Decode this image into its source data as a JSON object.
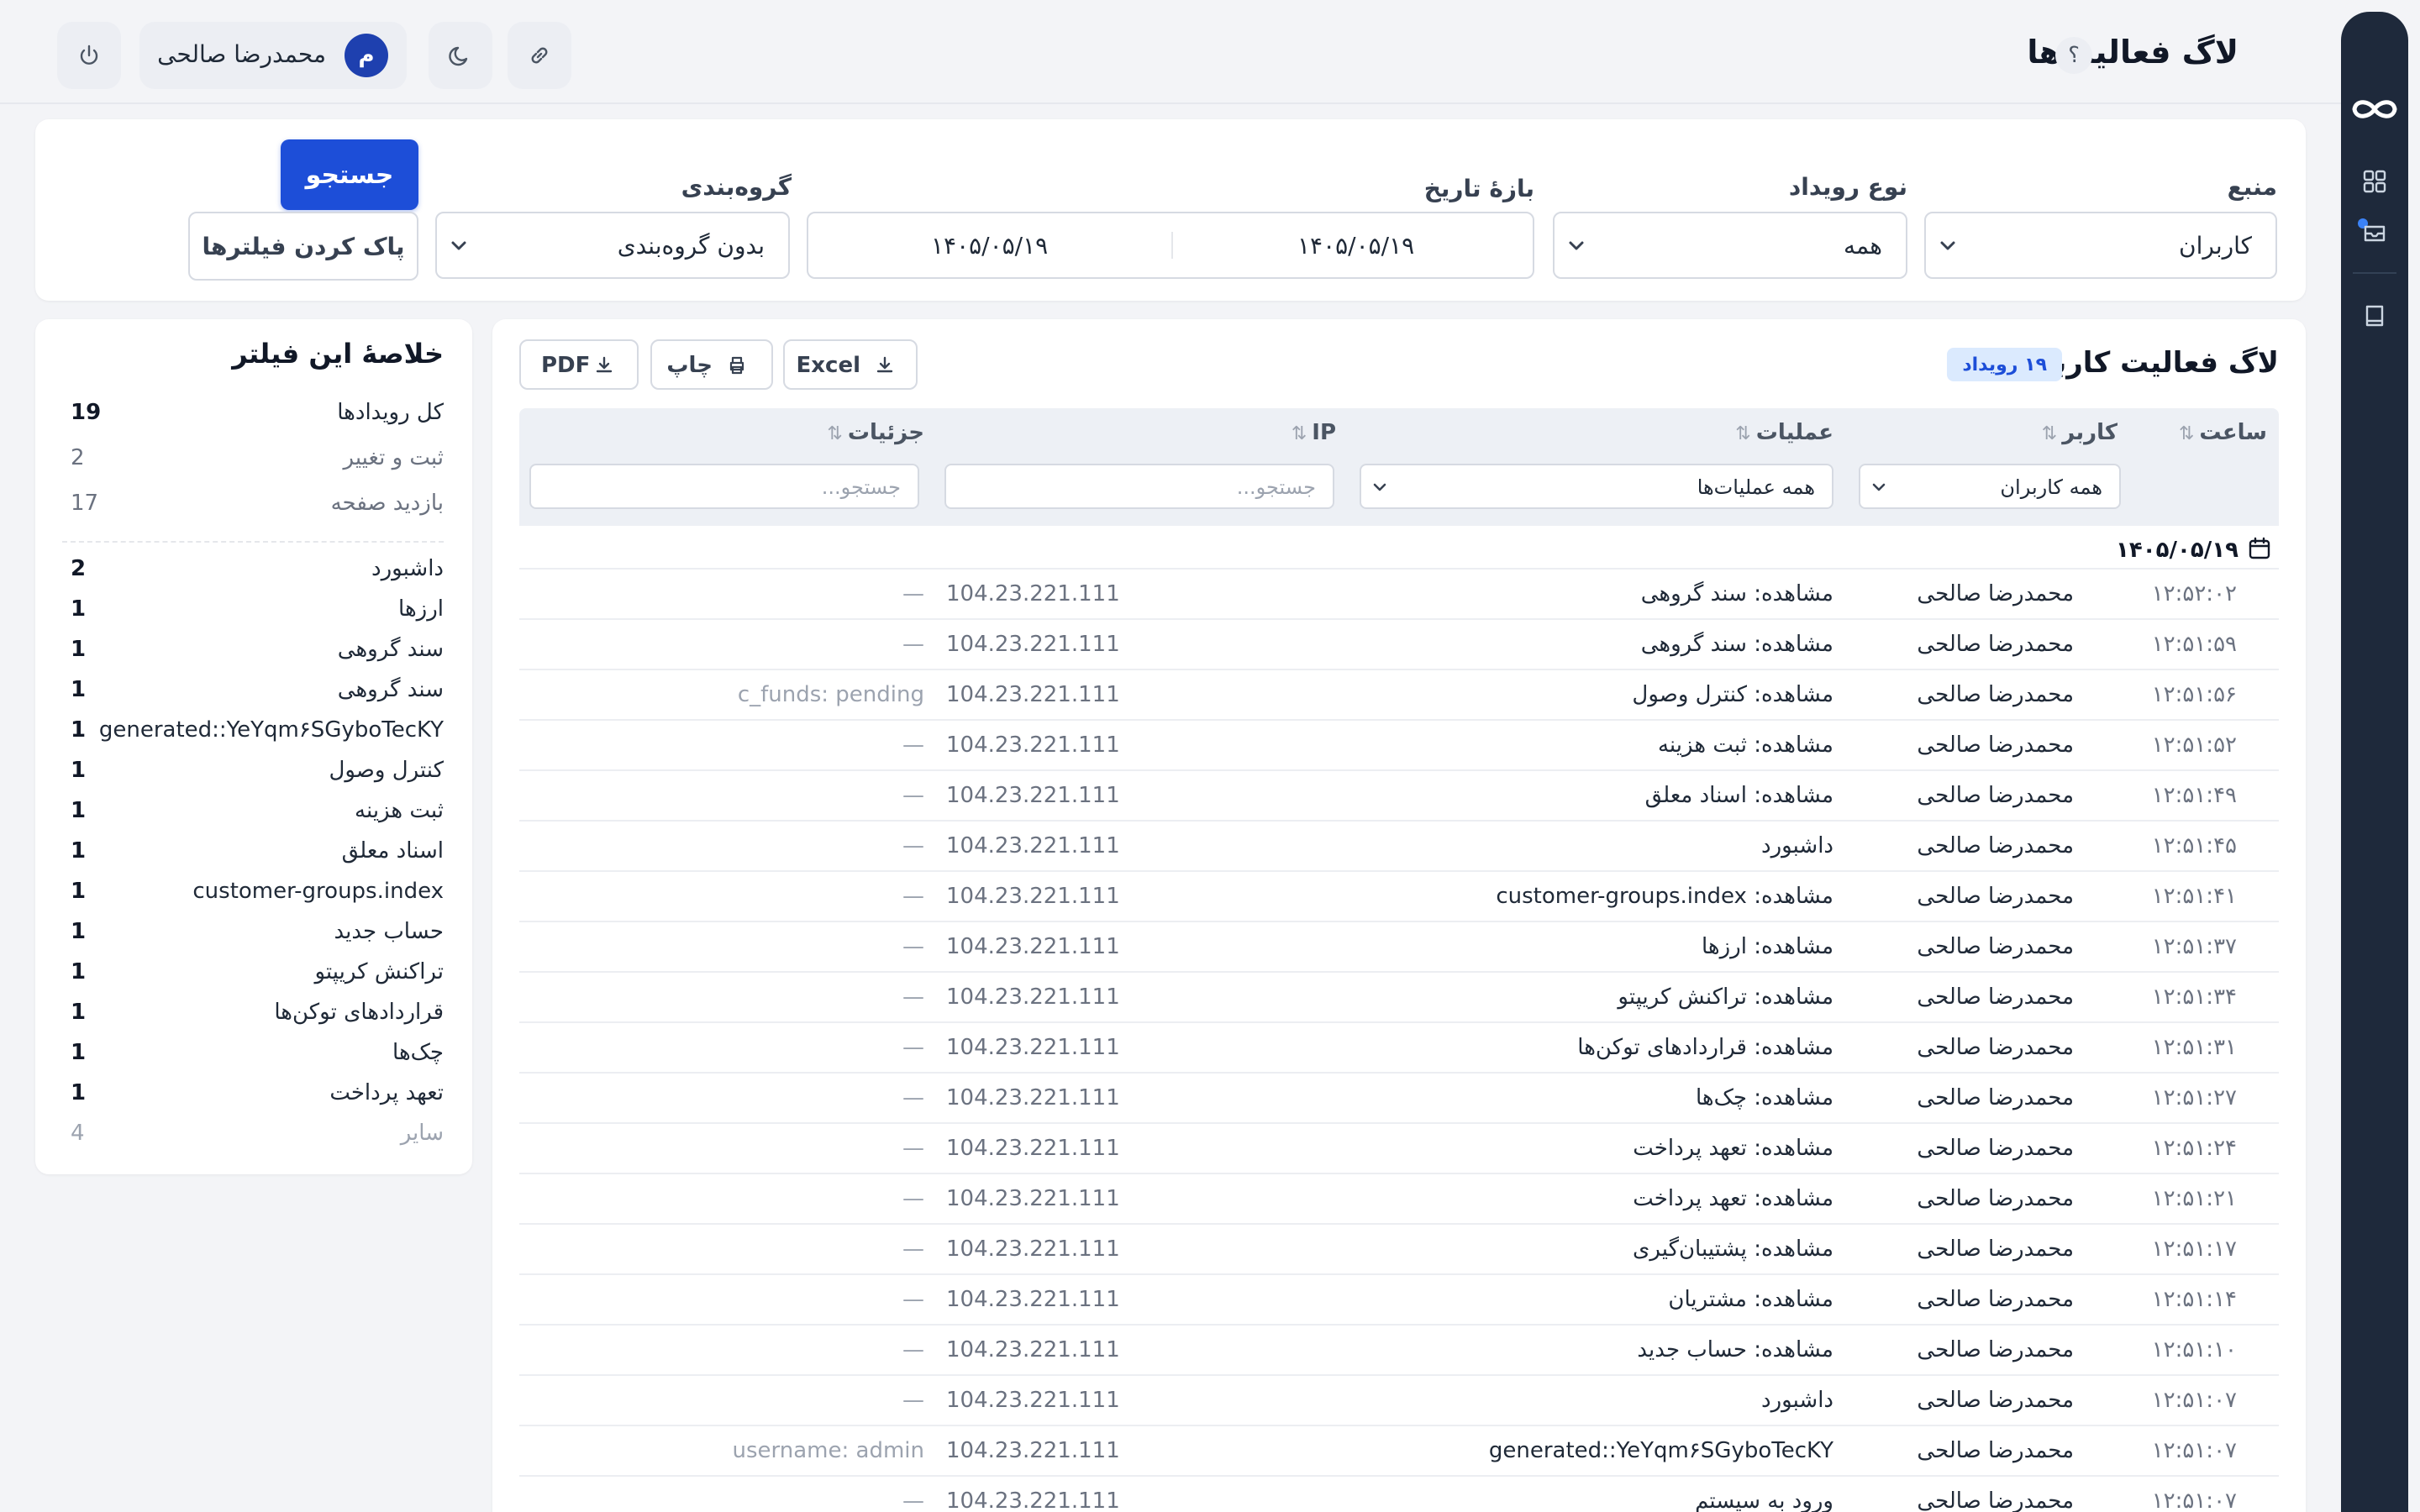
{
  "header": {
    "title": "لاگ فعالیت‌ها",
    "help": "؟",
    "user_name": "محمدرضا صالحی",
    "user_initial": "م"
  },
  "filters": {
    "source": {
      "label": "منبع",
      "value": "کاربران"
    },
    "event_type": {
      "label": "نوع رویداد",
      "value": "همه"
    },
    "date_range": {
      "label": "بازهٔ تاریخ",
      "from": "۱۴۰۵/۰۵/۱۹",
      "to": "۱۴۰۵/۰۵/۱۹"
    },
    "grouping": {
      "label": "گروه‌بندی",
      "value": "بدون گروه‌بندی"
    },
    "search_button": "جستجو",
    "clear_button": "پاک کردن فیلترها"
  },
  "summary": {
    "title": "خلاصهٔ این فیلتر",
    "totals": [
      {
        "label": "کل رویدادها",
        "count": "19"
      },
      {
        "label": "ثبت و تغییر",
        "count": "2"
      },
      {
        "label": "بازدید صفحه",
        "count": "17"
      }
    ],
    "pages": [
      {
        "label": "داشبورد",
        "count": "2"
      },
      {
        "label": "ارزها",
        "count": "1"
      },
      {
        "label": "سند گروهی",
        "count": "1"
      },
      {
        "label": "سند گروهی",
        "count": "1"
      },
      {
        "label": "generated::YeYqm۶SGyboTecKY",
        "count": "1"
      },
      {
        "label": "کنترل وصول",
        "count": "1"
      },
      {
        "label": "ثبت هزینه",
        "count": "1"
      },
      {
        "label": "اسناد معلق",
        "count": "1"
      },
      {
        "label": "customer-groups.index",
        "count": "1"
      },
      {
        "label": "حساب جدید",
        "count": "1"
      },
      {
        "label": "تراکنش کریپتو",
        "count": "1"
      },
      {
        "label": "قراردادهای توکن‌ها",
        "count": "1"
      },
      {
        "label": "چک‌ها",
        "count": "1"
      },
      {
        "label": "تعهد پرداخت",
        "count": "1"
      },
      {
        "label": "سایر",
        "count": "4"
      }
    ]
  },
  "table": {
    "title": "لاگ فعالیت کاربران",
    "count_badge": "۱۹ رویداد",
    "actions": {
      "excel": "Excel",
      "print": "چاپ",
      "pdf": "PDF"
    },
    "columns": {
      "time": "ساعت",
      "user": "کاربر",
      "operation": "عملیات",
      "ip": "IP",
      "details": "جزئیات"
    },
    "column_filters": {
      "user": "همه کاربران",
      "operation": "همه عملیات‌ها",
      "ip_placeholder": "جستجو...",
      "details_placeholder": "جستجو..."
    },
    "group_date": "۱۴۰۵/۰۵/۱۹",
    "rows": [
      {
        "time": "۱۲:۵۲:۰۲",
        "user": "محمدرضا صالحی",
        "operation": "مشاهده: سند گروهی",
        "ip": "104.23.221.111",
        "details": "—"
      },
      {
        "time": "۱۲:۵۱:۵۹",
        "user": "محمدرضا صالحی",
        "operation": "مشاهده: سند گروهی",
        "ip": "104.23.221.111",
        "details": "—"
      },
      {
        "time": "۱۲:۵۱:۵۶",
        "user": "محمدرضا صالحی",
        "operation": "مشاهده: کنترل وصول",
        "ip": "104.23.221.111",
        "details": "c_funds: pending"
      },
      {
        "time": "۱۲:۵۱:۵۲",
        "user": "محمدرضا صالحی",
        "operation": "مشاهده: ثبت هزینه",
        "ip": "104.23.221.111",
        "details": "—"
      },
      {
        "time": "۱۲:۵۱:۴۹",
        "user": "محمدرضا صالحی",
        "operation": "مشاهده: اسناد معلق",
        "ip": "104.23.221.111",
        "details": "—"
      },
      {
        "time": "۱۲:۵۱:۴۵",
        "user": "محمدرضا صالحی",
        "operation": "داشبورد",
        "ip": "104.23.221.111",
        "details": "—"
      },
      {
        "time": "۱۲:۵۱:۴۱",
        "user": "محمدرضا صالحی",
        "operation": "مشاهده: customer-groups.index",
        "ip": "104.23.221.111",
        "details": "—"
      },
      {
        "time": "۱۲:۵۱:۳۷",
        "user": "محمدرضا صالحی",
        "operation": "مشاهده: ارزها",
        "ip": "104.23.221.111",
        "details": "—"
      },
      {
        "time": "۱۲:۵۱:۳۴",
        "user": "محمدرضا صالحی",
        "operation": "مشاهده: تراکنش کریپتو",
        "ip": "104.23.221.111",
        "details": "—"
      },
      {
        "time": "۱۲:۵۱:۳۱",
        "user": "محمدرضا صالحی",
        "operation": "مشاهده: قراردادهای توکن‌ها",
        "ip": "104.23.221.111",
        "details": "—"
      },
      {
        "time": "۱۲:۵۱:۲۷",
        "user": "محمدرضا صالحی",
        "operation": "مشاهده: چک‌ها",
        "ip": "104.23.221.111",
        "details": "—"
      },
      {
        "time": "۱۲:۵۱:۲۴",
        "user": "محمدرضا صالحی",
        "operation": "مشاهده: تعهد پرداخت",
        "ip": "104.23.221.111",
        "details": "—"
      },
      {
        "time": "۱۲:۵۱:۲۱",
        "user": "محمدرضا صالحی",
        "operation": "مشاهده: تعهد پرداخت",
        "ip": "104.23.221.111",
        "details": "—"
      },
      {
        "time": "۱۲:۵۱:۱۷",
        "user": "محمدرضا صالحی",
        "operation": "مشاهده: پشتیبان‌گیری",
        "ip": "104.23.221.111",
        "details": "—"
      },
      {
        "time": "۱۲:۵۱:۱۴",
        "user": "محمدرضا صالحی",
        "operation": "مشاهده: مشتریان",
        "ip": "104.23.221.111",
        "details": "—"
      },
      {
        "time": "۱۲:۵۱:۱۰",
        "user": "محمدرضا صالحی",
        "operation": "مشاهده: حساب جدید",
        "ip": "104.23.221.111",
        "details": "—"
      },
      {
        "time": "۱۲:۵۱:۰۷",
        "user": "محمدرضا صالحی",
        "operation": "داشبورد",
        "ip": "104.23.221.111",
        "details": "—"
      },
      {
        "time": "۱۲:۵۱:۰۷",
        "user": "محمدرضا صالحی",
        "operation": "generated::YeYqm۶SGyboTecKY",
        "ip": "104.23.221.111",
        "details": "username: admin"
      },
      {
        "time": "۱۲:۵۱:۰۷",
        "user": "محمدرضا صالحی",
        "operation": "ورود به سیستم",
        "ip": "104.23.221.111",
        "details": "—"
      }
    ]
  },
  "icons": {
    "rail": [
      "infinity-logo-icon",
      "grid-icon",
      "inbox-icon",
      "book-icon"
    ],
    "topbar": [
      "power-icon",
      "moon-icon",
      "link-icon"
    ]
  },
  "colors": {
    "primary": "#1d4ed8",
    "rail": "#1e293b",
    "badge_bg": "#dbeafe"
  }
}
